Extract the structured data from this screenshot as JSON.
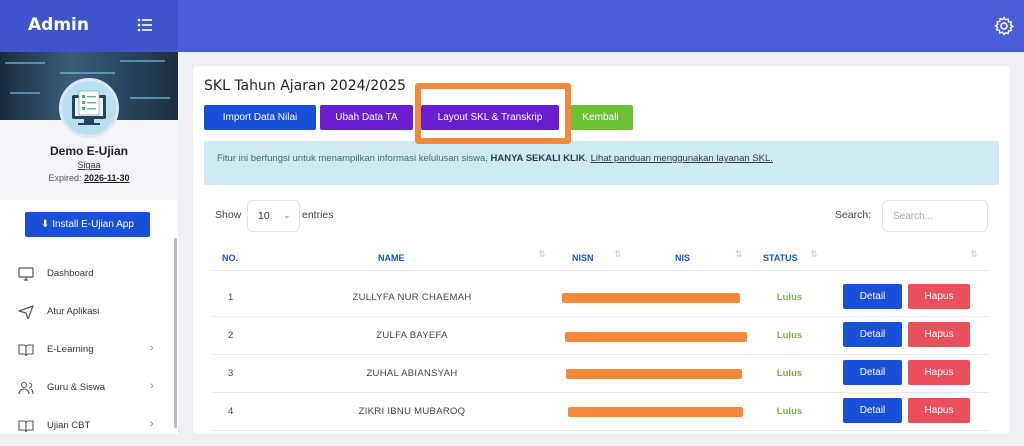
{
  "app": {
    "brand": "Admin"
  },
  "profile": {
    "name": "Demo E-Ujian",
    "school": "Sigaa",
    "expired_label": "Expired:",
    "expired_date": "2026-11-30"
  },
  "install_button": "Install E-Ujian App",
  "sidebar": {
    "items": [
      {
        "label": "Dashboard",
        "icon": "monitor-icon",
        "chevron": false
      },
      {
        "label": "Atur Aplikasi",
        "icon": "send-icon",
        "chevron": false
      },
      {
        "label": "E-Learning",
        "icon": "book-icon",
        "chevron": true
      },
      {
        "label": "Guru & Siswa",
        "icon": "users-icon",
        "chevron": true
      },
      {
        "label": "Ujian CBT",
        "icon": "book-open-icon",
        "chevron": true
      }
    ]
  },
  "page": {
    "title": "SKL Tahun Ajaran 2024/2025",
    "buttons": {
      "import": "Import Data Nilai",
      "ubah": "Ubah Data TA",
      "layout": "Layout SKL & Transkrip",
      "kembali": "Kembali"
    },
    "alert": {
      "text": "Fitur ini berfungsi untuk menampilkan informasi kelulusan siswa,",
      "bold": "HANYA SEKALI KLIK",
      "link": "Lihat panduan menggunakan layanan SKL."
    }
  },
  "table": {
    "show_label": "Show",
    "entries_value": "10",
    "entries_label": "entries",
    "search_label": "Search:",
    "search_placeholder": "Search...",
    "headers": {
      "no": "NO.",
      "name": "NAME",
      "nisn": "NISN",
      "nis": "NIS",
      "status": "STATUS"
    },
    "detail_label": "Detail",
    "hapus_label": "Hapus",
    "rows": [
      {
        "no": "1",
        "name": "ZULLYFA NUR CHAEMAH",
        "status": "Lulus"
      },
      {
        "no": "2",
        "name": "ZULFA BAYEFA",
        "status": "Lulus"
      },
      {
        "no": "3",
        "name": "ZUHAL ABIANSYAH",
        "status": "Lulus"
      },
      {
        "no": "4",
        "name": "ZIKRI IBNU MUBAROQ",
        "status": "Lulus"
      }
    ]
  },
  "colors": {
    "primary": "#1a4fd8",
    "purple": "#6a1ed0",
    "green": "#6cc134",
    "danger": "#ea4f5e",
    "highlight": "#f5883a",
    "topbar": "#4a5ed6"
  }
}
